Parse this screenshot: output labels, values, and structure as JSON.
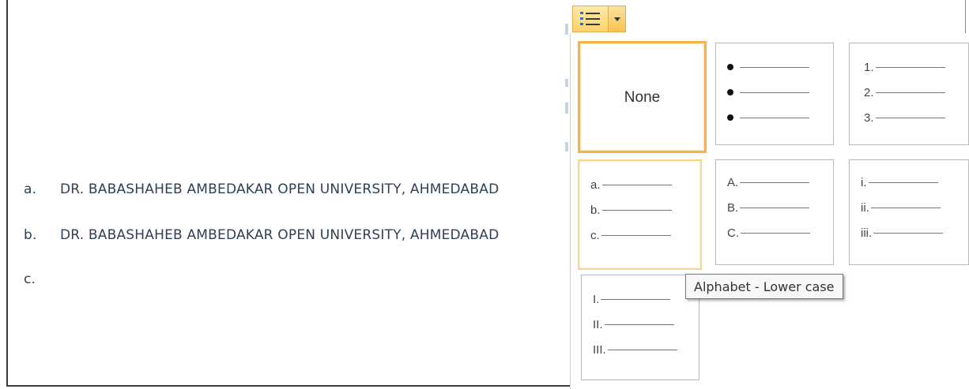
{
  "document": {
    "lines": [
      {
        "marker": "a.",
        "text": "DR. BABASHAHEB AMBEDAKAR OPEN UNIVERSITY, AHMEDABAD"
      },
      {
        "marker": "b.",
        "text": "DR. BABASHAHEB AMBEDAKAR OPEN UNIVERSITY, AHMEDABAD"
      },
      {
        "marker": "c.",
        "text": ""
      }
    ]
  },
  "numbering_button": {
    "icon": "numbered-list-icon",
    "dropdown_icon": "chevron-down-icon"
  },
  "numbering_library": {
    "none_label": "None",
    "bullet_tile": {
      "markers": [
        "•",
        "•",
        "•"
      ]
    },
    "number_tile": {
      "markers": [
        "1.",
        "2.",
        "3."
      ]
    },
    "lower_alpha_tile": {
      "markers": [
        "a.",
        "b.",
        "c."
      ]
    },
    "upper_alpha_tile": {
      "markers": [
        "A.",
        "B.",
        "C."
      ]
    },
    "lower_roman_tile": {
      "markers": [
        "i.",
        "ii.",
        "iii."
      ]
    },
    "upper_roman_tile": {
      "markers": [
        "I.",
        "II.",
        "III."
      ]
    }
  },
  "tooltip": "Alphabet - Lower case",
  "colors": {
    "accent": "#f3b54a",
    "text": "#2f3f54"
  }
}
